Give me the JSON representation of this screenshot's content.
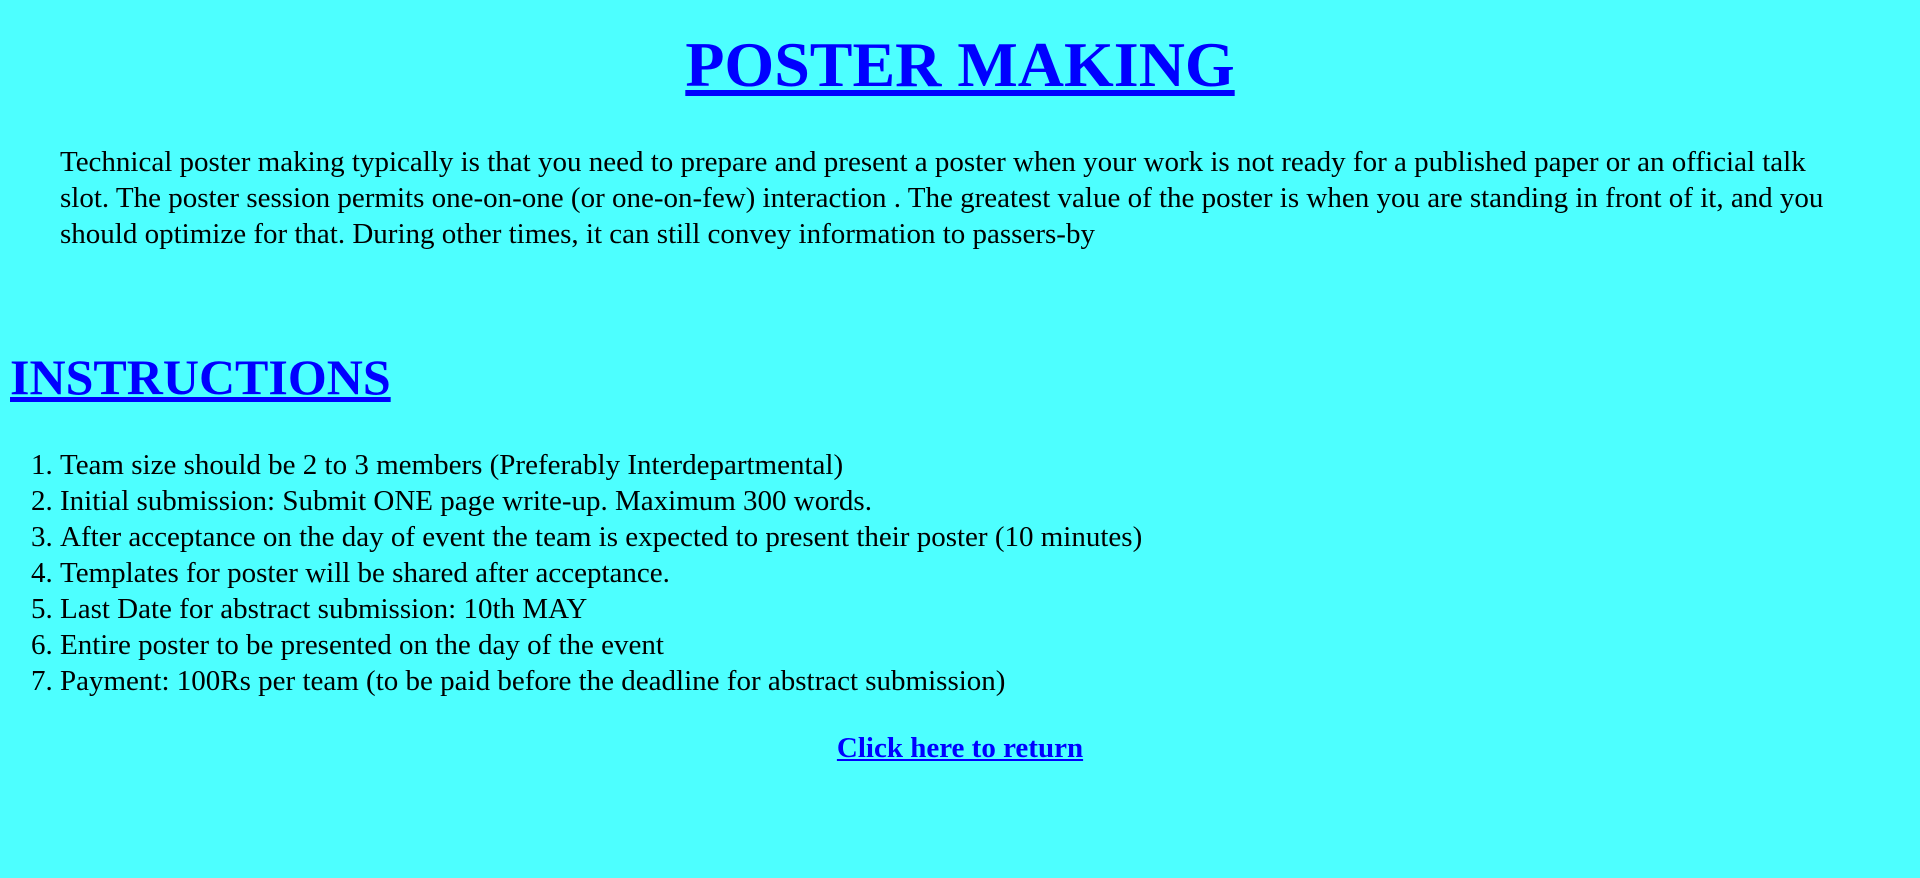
{
  "header": {
    "title": "POSTER MAKING"
  },
  "intro": {
    "text": "Technical poster making typically is that you need to prepare and present a poster when your work is not ready for a published paper or an official talk slot. The poster session permits one-on-one (or one-on-few) interaction . The greatest value of the poster is when you are standing in front of it, and you should optimize for that. During other times, it can still convey information to passers-by"
  },
  "instructions": {
    "title": "INSTRUCTIONS",
    "items": [
      "Team size should be 2 to 3 members (Preferably Interdepartmental)",
      "Initial submission: Submit ONE page write-up. Maximum 300 words.",
      "After acceptance on the day of event the team is expected to present their poster (10 minutes)",
      "Templates for poster will be shared after acceptance.",
      "Last Date for abstract submission: 10th MAY",
      "Entire poster to be presented on the day of the event",
      "Payment: 100Rs per team (to be paid before the deadline for abstract submission)"
    ]
  },
  "footer": {
    "return_label": "Click here to return"
  },
  "colors": {
    "background": "#4dffff",
    "link": "#0000ff",
    "text": "#000000"
  }
}
